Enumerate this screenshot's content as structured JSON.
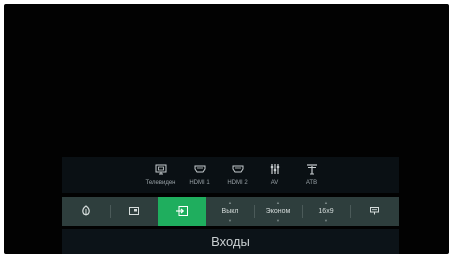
{
  "sources": [
    {
      "label": "Телевиден",
      "icon": "tv-icon"
    },
    {
      "label": "HDMI 1",
      "icon": "hdmi-icon"
    },
    {
      "label": "HDMI 2",
      "icon": "hdmi-icon"
    },
    {
      "label": "AV",
      "icon": "av-icon"
    },
    {
      "label": "АТВ",
      "icon": "antenna-icon"
    }
  ],
  "toolbar": {
    "active_item": "input",
    "picture_mode_value": "Выкл",
    "energy_value": "Эконом",
    "aspect_value": "16x9"
  },
  "panel_title": "Входы",
  "colors": {
    "accent_green": "#1fae5e",
    "toolbar_bg": "#2e3e3d",
    "screen_bg": "#020202"
  }
}
